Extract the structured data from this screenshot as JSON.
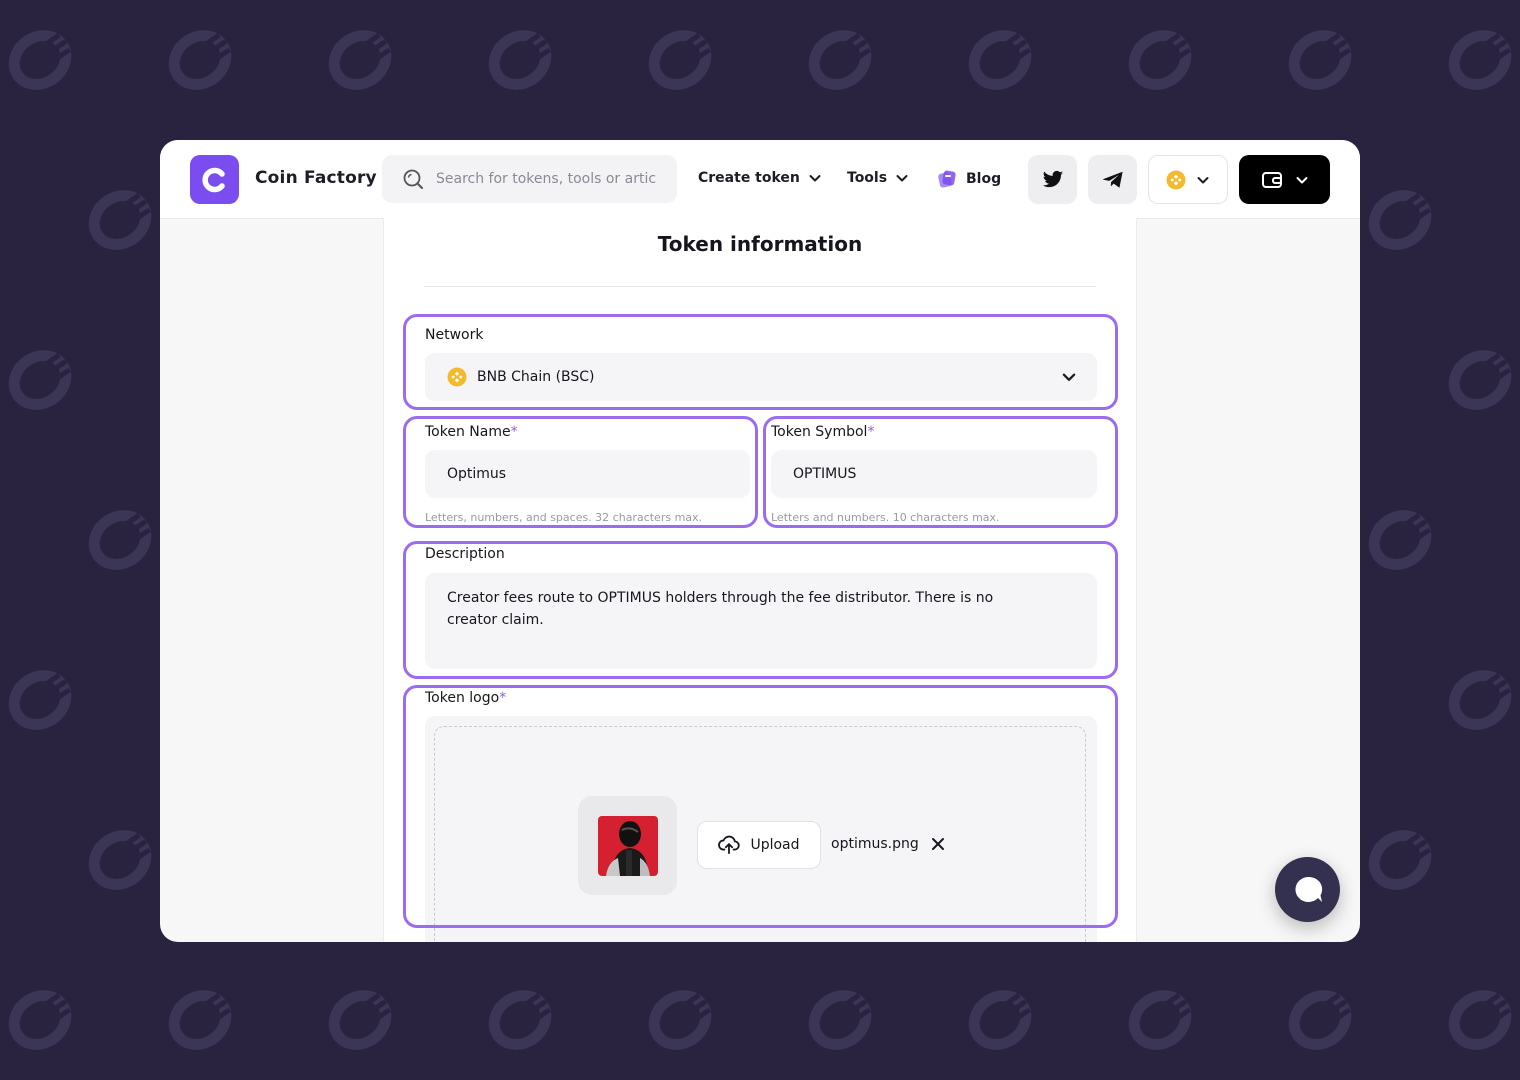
{
  "app": {
    "brand": "Coin Factory"
  },
  "search": {
    "placeholder": "Search for tokens, tools or artic"
  },
  "nav": {
    "create_token": "Create token",
    "tools": "Tools",
    "blog": "Blog"
  },
  "form": {
    "title": "Token information",
    "network": {
      "label": "Network",
      "value": "BNB Chain (BSC)"
    },
    "token_name": {
      "label": "Token Name",
      "required_mark": "*",
      "value": "Optimus",
      "hint": "Letters, numbers, and spaces. 32 characters max."
    },
    "token_symbol": {
      "label": "Token Symbol",
      "required_mark": "*",
      "value": "OPTIMUS",
      "hint": "Letters and numbers. 10 characters max."
    },
    "description": {
      "label": "Description",
      "value": "Creator fees route to OPTIMUS holders through the fee distributor. There is no creator claim."
    },
    "token_logo": {
      "label": "Token logo",
      "required_mark": "*",
      "upload_label": "Upload",
      "filename": "optimus.png"
    }
  },
  "colors": {
    "background": "#2a2340",
    "accent": "#7b4cf0",
    "highlight": "#9b6cf0",
    "bnb": "#f3ba2f"
  },
  "icons": {
    "search": "search-icon",
    "chevron": "chevron-down-icon",
    "twitter": "twitter-icon",
    "telegram": "telegram-icon",
    "wallet": "wallet-icon",
    "upload": "cloud-upload-icon",
    "close": "close-icon",
    "chat": "chat-icon"
  }
}
